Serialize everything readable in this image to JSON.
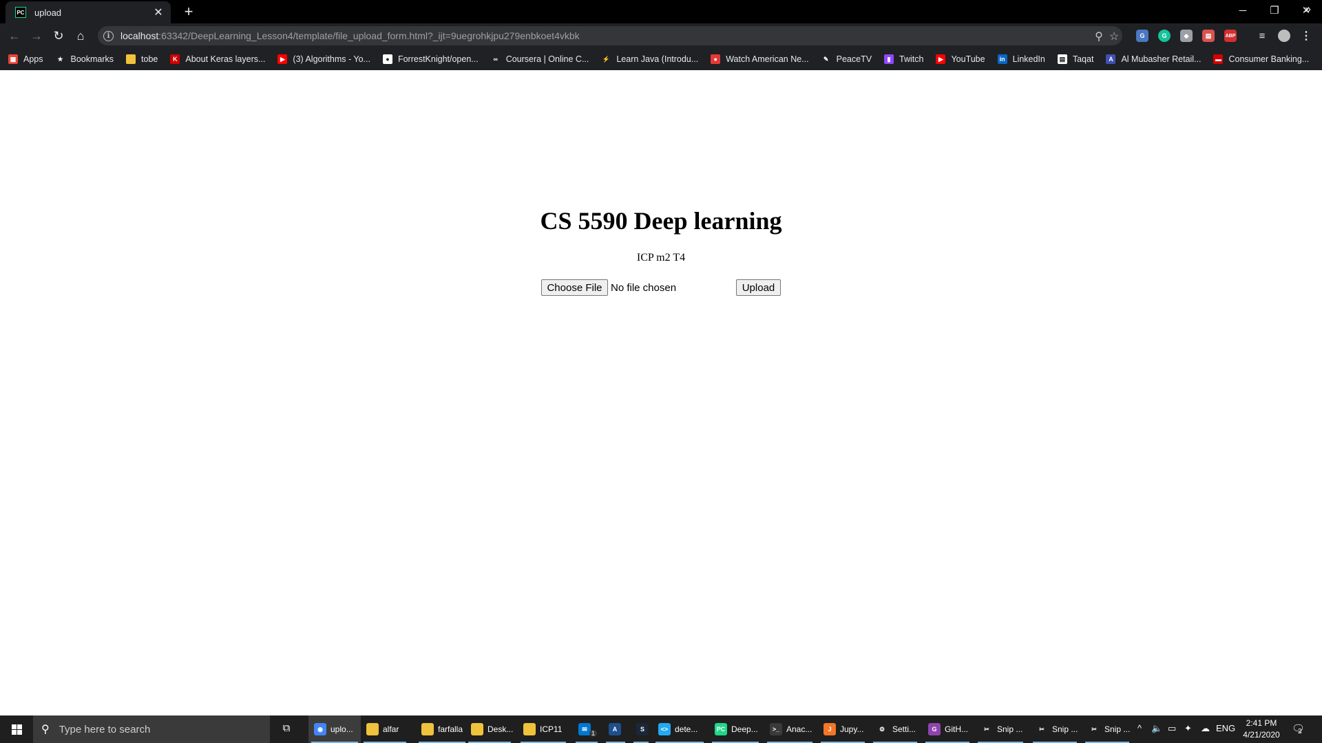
{
  "browser": {
    "tab_title": "upload",
    "url_host": "localhost",
    "url_rest": ":63342/DeepLearning_Lesson4/template/file_upload_form.html?_ijt=9uegrohkjpu279enbkoet4vkbk"
  },
  "bookmarks": [
    {
      "label": "Apps",
      "icon": "apps-grid-icon"
    },
    {
      "label": "Bookmarks",
      "icon": "star-icon"
    },
    {
      "label": "tobe",
      "icon": "folder-icon"
    },
    {
      "label": "About Keras layers...",
      "icon": "keras-icon"
    },
    {
      "label": "(3) Algorithms - Yo...",
      "icon": "youtube-icon"
    },
    {
      "label": "ForrestKnight/open...",
      "icon": "github-icon"
    },
    {
      "label": "Coursera | Online C...",
      "icon": "coursera-icon"
    },
    {
      "label": "Learn Java (Introdu...",
      "icon": "learn-java-icon"
    },
    {
      "label": "Watch American Ne...",
      "icon": "news-icon"
    },
    {
      "label": "PeaceTV",
      "icon": "peacetv-icon"
    },
    {
      "label": "Twitch",
      "icon": "twitch-icon"
    },
    {
      "label": "YouTube",
      "icon": "youtube-icon"
    },
    {
      "label": "LinkedIn",
      "icon": "linkedin-icon"
    },
    {
      "label": "Taqat",
      "icon": "taqat-icon"
    },
    {
      "label": "Al Mubasher Retail...",
      "icon": "mubasher-icon"
    },
    {
      "label": "Consumer Banking...",
      "icon": "bank-icon"
    }
  ],
  "page": {
    "heading": "CS 5590 Deep learning",
    "subtitle": "ICP m2 T4",
    "choose_file_label": "Choose File",
    "no_file_text": "No file chosen",
    "upload_label": "Upload"
  },
  "taskbar": {
    "search_placeholder": "Type here to search",
    "apps": [
      {
        "label": "uplo...",
        "icon": "chrome-icon",
        "active": true
      },
      {
        "label": "alfar",
        "icon": "folder-icon"
      },
      {
        "label": "farfalla",
        "icon": "folder-icon"
      },
      {
        "label": "Desk...",
        "icon": "folder-icon"
      },
      {
        "label": "ICP11",
        "icon": "folder-icon"
      },
      {
        "label": "",
        "icon": "mail-icon",
        "badge": "1"
      },
      {
        "label": "",
        "icon": "azure-icon"
      },
      {
        "label": "",
        "icon": "steam-icon"
      },
      {
        "label": "dete...",
        "icon": "vscode-icon"
      },
      {
        "label": "Deep...",
        "icon": "pycharm-icon"
      },
      {
        "label": "Anac...",
        "icon": "terminal-icon"
      },
      {
        "label": "Jupy...",
        "icon": "jupyter-icon"
      },
      {
        "label": "Setti...",
        "icon": "settings-gear-icon"
      },
      {
        "label": "GitH...",
        "icon": "github-desktop-icon"
      },
      {
        "label": "Snip ...",
        "icon": "snip-icon"
      },
      {
        "label": "Snip ...",
        "icon": "snip-icon"
      },
      {
        "label": "Snip ...",
        "icon": "snip-icon"
      }
    ],
    "language": "ENG",
    "time": "2:41 PM",
    "date": "4/21/2020",
    "notification_count": "2"
  },
  "colors": {
    "chrome_dark": "#202124",
    "taskbar": "#1f1f1f",
    "active_underline": "#76b9ed"
  }
}
